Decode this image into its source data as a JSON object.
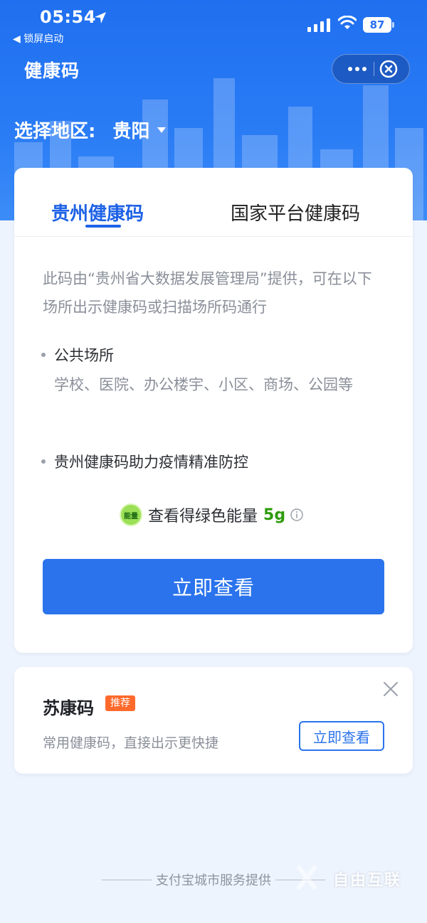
{
  "status_bar": {
    "time": "05:54",
    "back_app": "◀ 锁屏启动",
    "battery": "87"
  },
  "nav": {
    "title": "健康码",
    "more_icon": "more-dots-icon",
    "close_icon": "close-circle-icon"
  },
  "region": {
    "label": "选择地区:",
    "value": "贵阳"
  },
  "tabs": [
    {
      "label": "贵州健康码",
      "active": true
    },
    {
      "label": "国家平台健康码",
      "active": false
    }
  ],
  "info": {
    "intro": "此码由“贵州省大数据发展管理局”提供，可在以下场所出示健康码或扫描场所码通行",
    "bullet_1": "公共场所",
    "bullet_1_desc": "学校、医院、办公楼宇、小区、商场、公园等",
    "bullet_2": "贵州健康码助力疫情精准防控"
  },
  "energy": {
    "badge": "能量",
    "text": "查看得绿色能量",
    "amount": "5g"
  },
  "main_button": "立即查看",
  "su_card": {
    "title": "苏康码",
    "badge": "推荐",
    "desc": "常用健康码，直接出示更快捷",
    "button": "立即查看"
  },
  "footer": "支付宝城市服务提供",
  "watermark": "自由互联",
  "colors": {
    "primary": "#2a73ec",
    "hero": "#1f6ff0",
    "badge": "#ff6a2c",
    "energy": "#2d9b0a"
  }
}
